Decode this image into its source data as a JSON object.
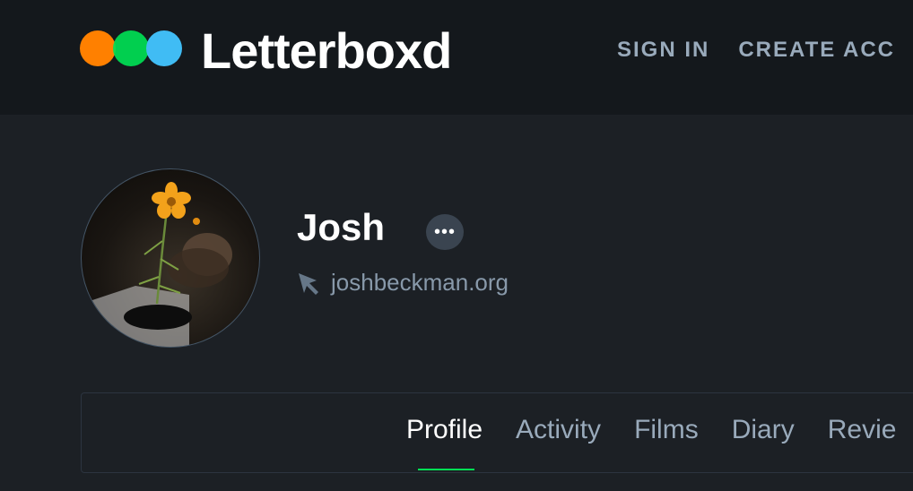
{
  "header": {
    "brand": "Letterboxd",
    "nav": [
      {
        "label": "SIGN IN"
      },
      {
        "label": "CREATE ACC"
      }
    ]
  },
  "profile": {
    "name": "Josh",
    "website": "joshbeckman.org",
    "more_label": "•••"
  },
  "tabs": [
    {
      "label": "Profile",
      "active": true
    },
    {
      "label": "Activity"
    },
    {
      "label": "Films"
    },
    {
      "label": "Diary"
    },
    {
      "label": "Revie"
    }
  ],
  "colors": {
    "orange": "#ff8000",
    "green": "#00e054",
    "blue": "#40bcf4",
    "background": "#1c2025",
    "header_bg": "#14181c"
  }
}
